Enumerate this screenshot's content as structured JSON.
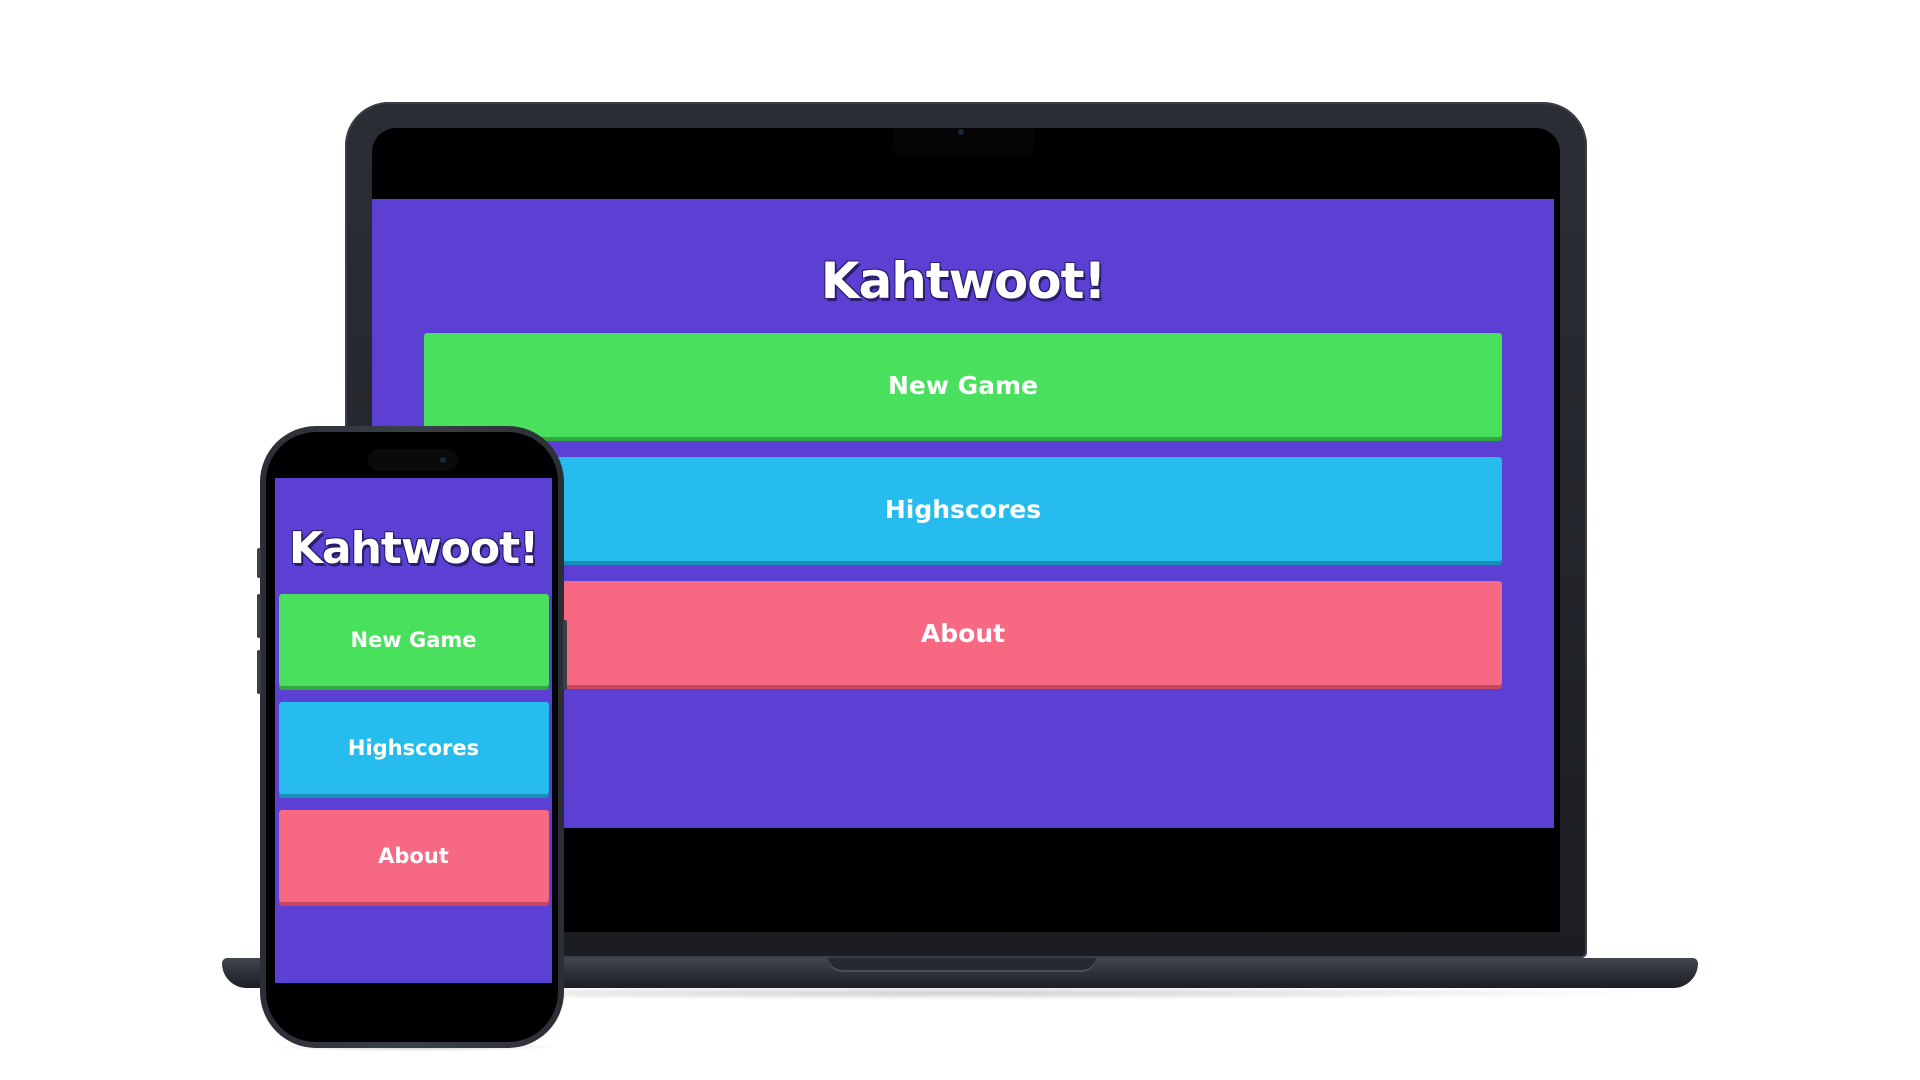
{
  "app": {
    "title": "Kahtwoot!",
    "menu": [
      {
        "label": "New Game",
        "color": "#48e05c"
      },
      {
        "label": "Highscores",
        "color": "#26bdee"
      },
      {
        "label": "About",
        "color": "#f76883"
      }
    ],
    "background_color": "#5c40d4"
  },
  "devices": {
    "laptop": "laptop",
    "phone": "phone"
  }
}
